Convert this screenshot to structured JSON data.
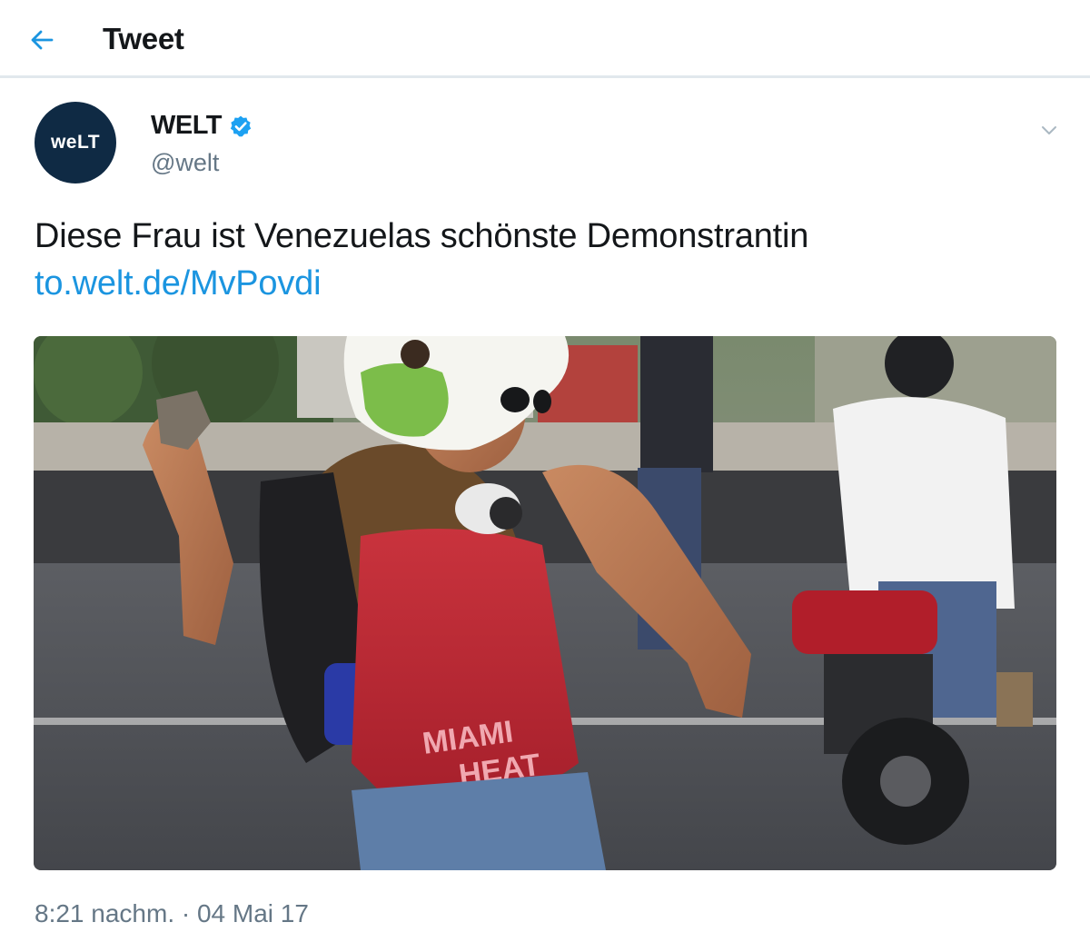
{
  "header": {
    "title": "Tweet",
    "back_icon": "arrow-left-icon"
  },
  "author": {
    "avatar_text": "weLT",
    "name": "WELT",
    "handle": "@welt",
    "verified_icon": "verified-badge-icon"
  },
  "tweet": {
    "text": "Diese Frau ist Venezuelas schönste Demonstrantin",
    "link": "to.welt.de/MvPovdi",
    "timestamp": "8:21 nachm. · 04 Mai 17",
    "media_shirt_text": [
      "MIAMI",
      "HEAT"
    ]
  },
  "colors": {
    "accent": "#1b95e0",
    "text": "#14171a",
    "muted": "#657786",
    "avatar_bg": "#0f2a44"
  }
}
